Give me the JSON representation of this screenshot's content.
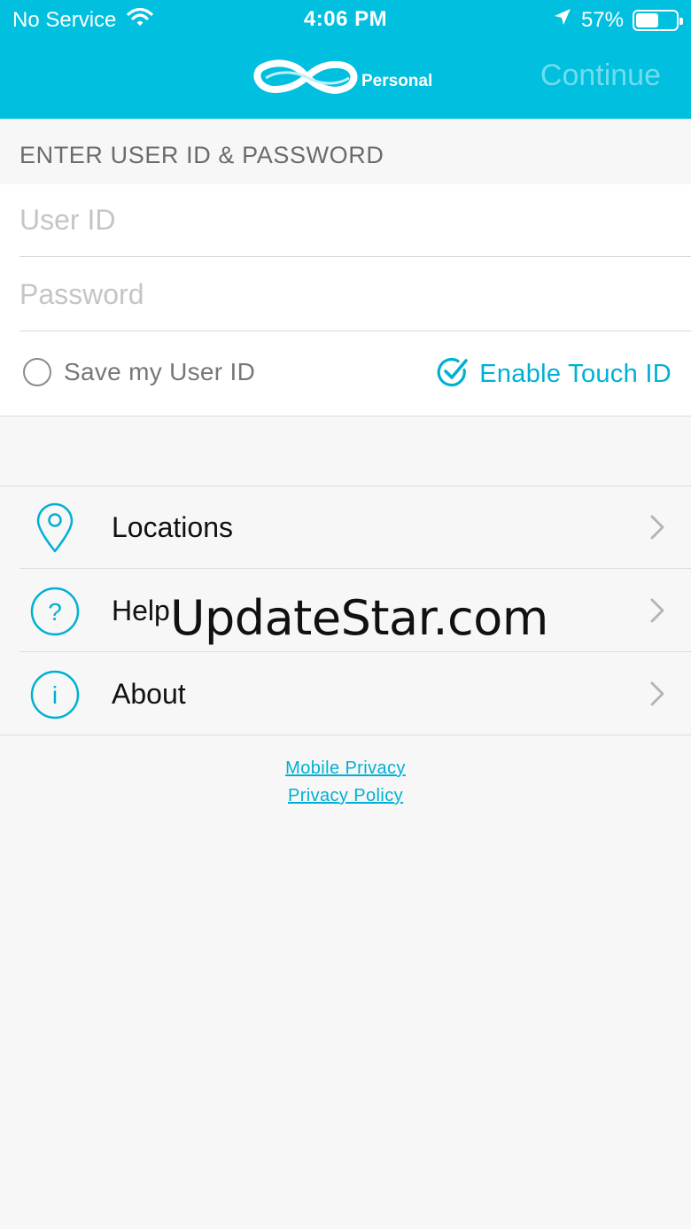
{
  "status_bar": {
    "carrier": "No Service",
    "time": "4:06 PM",
    "battery_percent": "57%",
    "battery_level": 0.57
  },
  "nav": {
    "logo_text": "Personal",
    "continue_label": "Continue"
  },
  "login": {
    "section_title": "ENTER USER ID & PASSWORD",
    "user_id_placeholder": "User ID",
    "password_placeholder": "Password",
    "save_user_id_label": "Save my User ID",
    "save_user_id_checked": false,
    "touch_id_label": "Enable Touch ID",
    "touch_id_enabled": true
  },
  "menu": {
    "items": [
      {
        "label": "Locations",
        "icon": "location-pin-icon"
      },
      {
        "label": "Help",
        "icon": "question-circle-icon"
      },
      {
        "label": "About",
        "icon": "info-circle-icon"
      }
    ]
  },
  "links": {
    "mobile_privacy": "Mobile Privacy",
    "privacy_policy": "Privacy Policy"
  },
  "watermark": "UpdateStar.com",
  "colors": {
    "header_bg": "#00bfdf",
    "accent": "#00b0d4",
    "continue_disabled": "#6fdcee",
    "page_bg": "#f7f7f7"
  }
}
